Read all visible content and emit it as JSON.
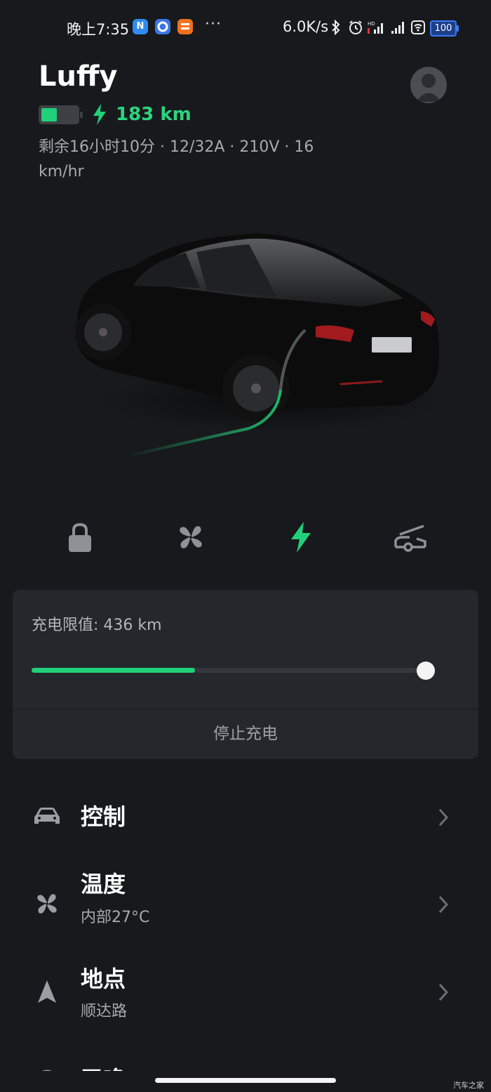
{
  "status_bar": {
    "time": "晚上7:35",
    "apps": [
      {
        "icon": "n-app-icon",
        "text": "N",
        "color": "#2f8cf0"
      },
      {
        "icon": "circle-app-icon",
        "text": "",
        "color": "#3a76e6"
      },
      {
        "icon": "bank-app-icon",
        "text": "",
        "color": "#f0711f"
      }
    ],
    "more": "···",
    "net_speed": "6.0K/s",
    "battery": "100"
  },
  "header": {
    "car_name": "Luffy",
    "range": "183 km",
    "charge_info": "剩余16小时10分 · 12/32A · 210V · 16 km/hr"
  },
  "quick_actions": [
    {
      "name": "lock",
      "icon": "lock-icon",
      "active": false
    },
    {
      "name": "climate",
      "icon": "fan-icon",
      "active": false
    },
    {
      "name": "charging",
      "icon": "bolt-icon",
      "active": true
    },
    {
      "name": "trunk",
      "icon": "trunk-open-icon",
      "active": false
    }
  ],
  "charge_card": {
    "limit_label": "充电限值: 436 km",
    "current_level_fraction": 0.415,
    "limit_fraction": 1.0,
    "stop_button": "停止充电"
  },
  "menu": [
    {
      "title": "控制",
      "subtitle": "",
      "icon": "car-icon"
    },
    {
      "title": "温度",
      "subtitle": "内部27°C",
      "icon": "fan-icon"
    },
    {
      "title": "地点",
      "subtitle": "顺达路",
      "icon": "navigation-arrow-icon"
    },
    {
      "title": "召唤",
      "subtitle": "",
      "icon": "summon-icon"
    }
  ],
  "colors": {
    "accent": "#21d07a",
    "background": "#17191c",
    "card": "#24272b"
  },
  "watermark": "汽车之家"
}
